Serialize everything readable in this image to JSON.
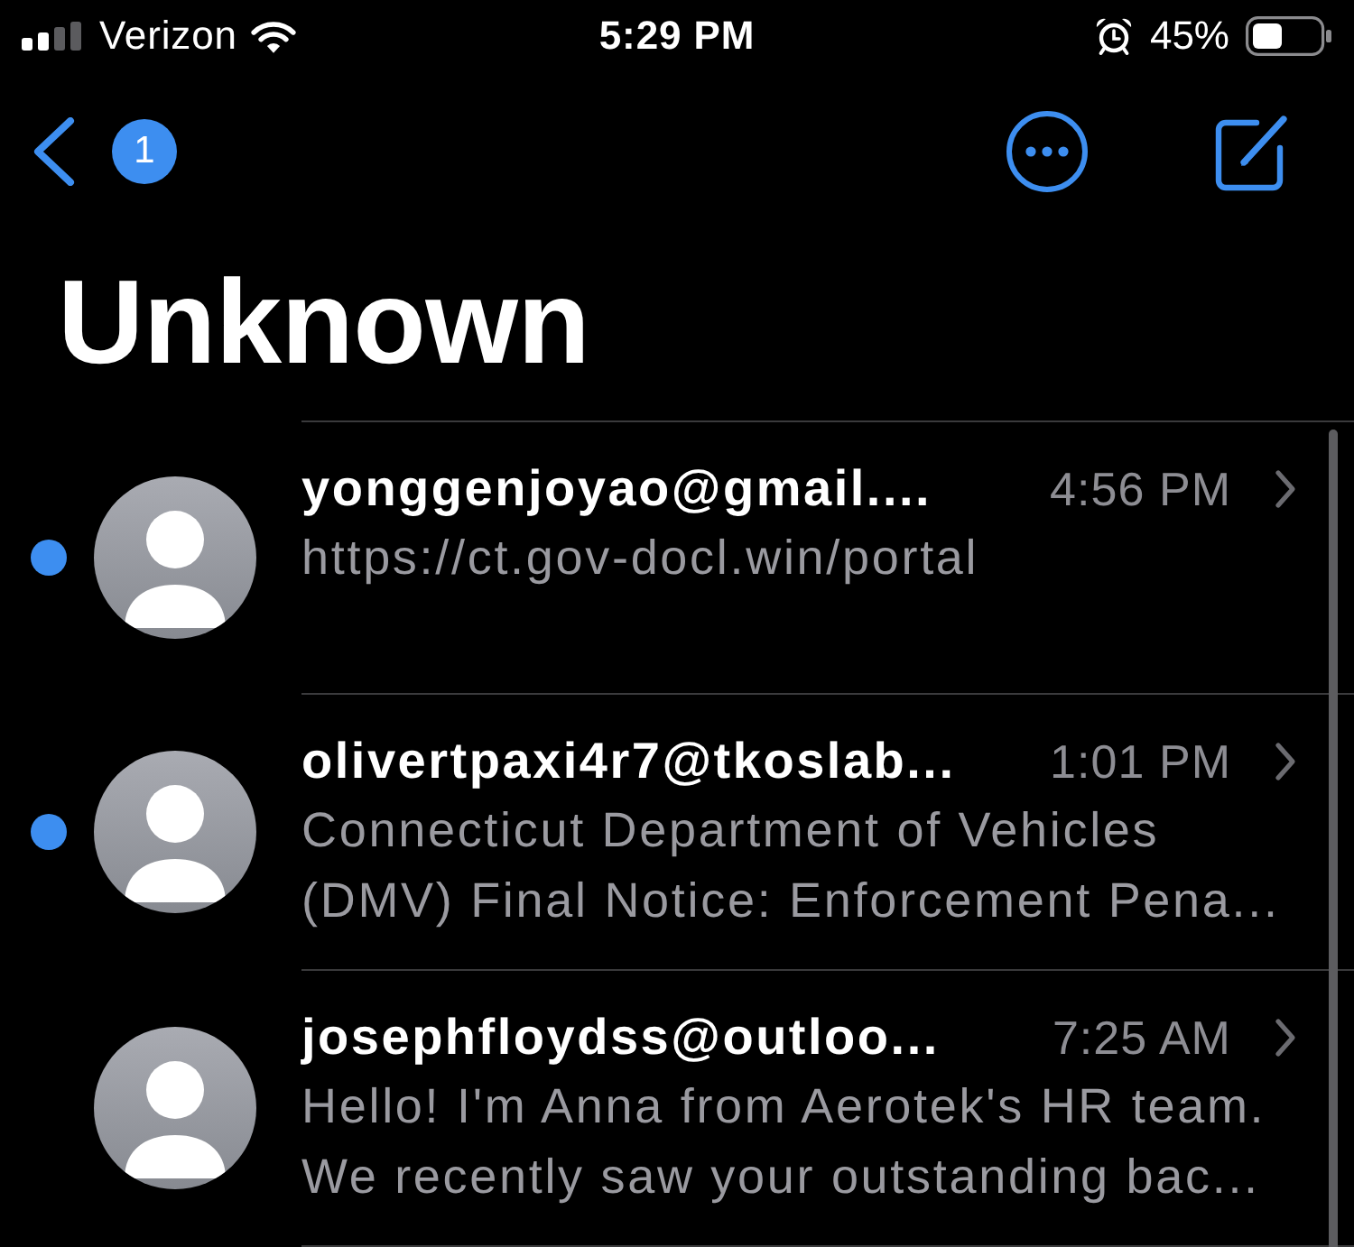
{
  "status_bar": {
    "carrier": "Verizon",
    "time": "5:29 PM",
    "battery": "45%"
  },
  "nav": {
    "badge": "1"
  },
  "title": "Unknown",
  "messages": [
    {
      "sender": "yonggenjoyao@gmail....",
      "time": "4:56 PM",
      "preview": "https://ct.gov-docl.win/portal",
      "unread": true
    },
    {
      "sender": "olivertpaxi4r7@tkoslab...",
      "time": "1:01 PM",
      "preview": "Connecticut Department of Vehicles (DMV) Final Notice: Enforcement Pena...",
      "unread": true
    },
    {
      "sender": "josephfloydss@outloo...",
      "time": "7:25 AM",
      "preview": "Hello! I'm Anna from Aerotek's HR team. We recently saw your outstanding bac...",
      "unread": false
    }
  ]
}
